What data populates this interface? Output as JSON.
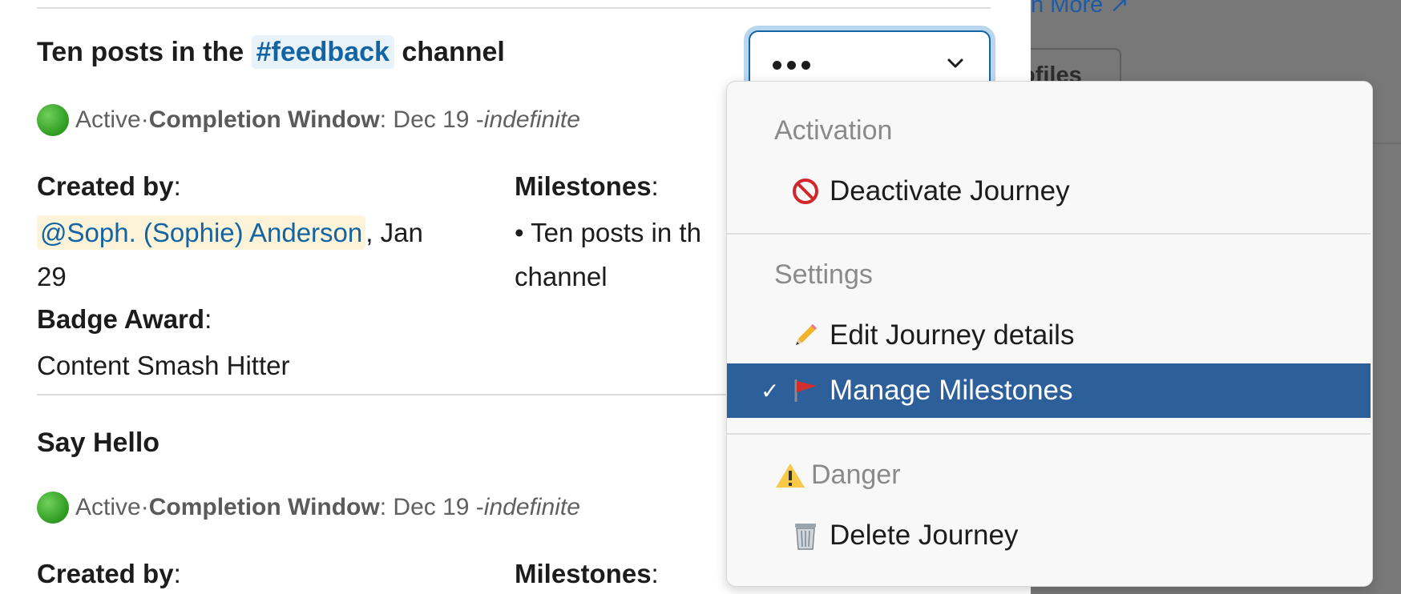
{
  "overlay": {
    "learn_more": "n More ↗",
    "profiles_button": "ofiles"
  },
  "journeys": [
    {
      "title_prefix": "Ten posts in the ",
      "channel": "#feedback",
      "title_suffix": " channel",
      "status": "Active",
      "separator": " · ",
      "window_label": "Completion Window",
      "window_range": ": Dec 19 - ",
      "window_end": "indefinite",
      "created_by_label": "Created by",
      "created_by_user": "@Soph. (Sophie) Anderson",
      "created_date_line1": ", Jan",
      "created_date_line2": "29",
      "milestones_label": "Milestones",
      "milestones_line1": "• Ten posts in th",
      "milestones_line2": "channel",
      "badge_label": "Badge Award",
      "badge_value": "Content Smash Hitter"
    },
    {
      "title": "Say Hello",
      "status": "Active",
      "separator": " · ",
      "window_label": "Completion Window",
      "window_range": ": Dec 19 - ",
      "window_end": "indefinite",
      "created_by_label": "Created by",
      "milestones_label": "Milestones"
    }
  ],
  "colon": ":",
  "menu": {
    "activation_header": "Activation",
    "deactivate": "Deactivate Journey",
    "settings_header": "Settings",
    "edit_details": "Edit Journey details",
    "manage_milestones": "Manage Milestones",
    "danger_header": "Danger",
    "delete": "Delete Journey",
    "check": "✓"
  },
  "icons": {
    "deactivate": "no-entry-icon",
    "edit": "pencil-icon",
    "manage": "triangular-flag-icon",
    "danger": "warning-icon",
    "delete": "wastebasket-icon",
    "status": "green-circle-icon"
  },
  "colors": {
    "accent": "#1264a3",
    "selected_row": "#2d5f9b",
    "mention_bg": "#fdf3d8",
    "channel_bg": "#e8f2f9"
  }
}
